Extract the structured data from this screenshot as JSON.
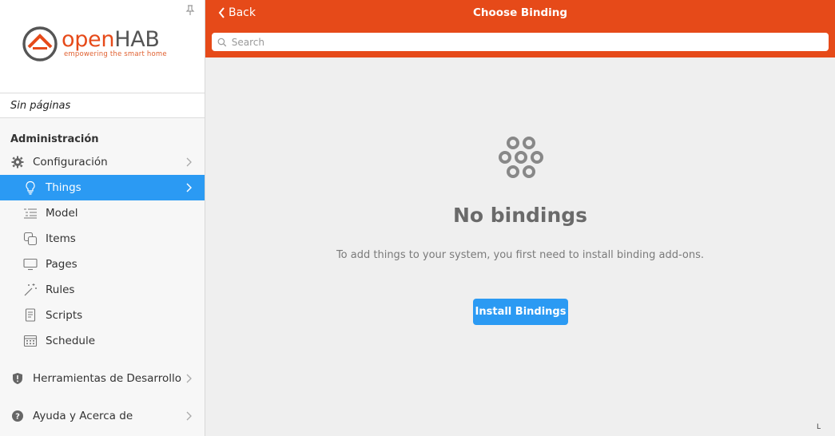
{
  "sidebar": {
    "logo": {
      "brand_open": "open",
      "brand_hab": "HAB",
      "tagline": "empowering the smart home"
    },
    "no_pages": "Sin páginas",
    "admin_title": "Administración",
    "config_label": "Configuración",
    "admin_items": [
      {
        "label": "Things",
        "icon": "lightbulb-icon"
      },
      {
        "label": "Model",
        "icon": "list-tree-icon"
      },
      {
        "label": "Items",
        "icon": "squares-icon"
      },
      {
        "label": "Pages",
        "icon": "monitor-icon"
      },
      {
        "label": "Rules",
        "icon": "magic-wand-icon"
      },
      {
        "label": "Scripts",
        "icon": "document-icon"
      },
      {
        "label": "Schedule",
        "icon": "calendar-icon"
      }
    ],
    "dev_tools_label": "Herramientas de Desarrollo",
    "help_label": "Ayuda y Acerca de"
  },
  "topbar": {
    "back_label": "Back",
    "title": "Choose Binding",
    "search_placeholder": "Search"
  },
  "empty": {
    "title": "No bindings",
    "text": "To add things to your system, you first need to install binding add-ons.",
    "button_label": "Install Bindings"
  },
  "corner_glyph": "L",
  "colors": {
    "accent": "#e64a19",
    "primary": "#2b9af3"
  }
}
